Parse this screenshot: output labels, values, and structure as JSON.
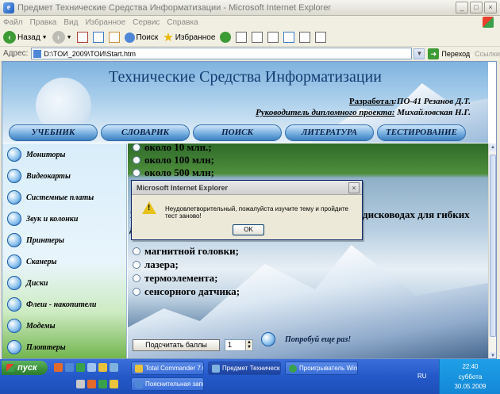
{
  "window": {
    "title": "Предмет Технические Средства Информатизации - Microsoft Internet Explorer",
    "minimize": "_",
    "maximize": "□",
    "close": "×"
  },
  "menu": [
    "Файл",
    "Правка",
    "Вид",
    "Избранное",
    "Сервис",
    "Справка"
  ],
  "toolbar": {
    "back": "Назад",
    "search": "Поиск",
    "favorites": "Избранное"
  },
  "address": {
    "label": "Адрес:",
    "url": "D:\\TOИ_2009\\TOИ\\Start.htm",
    "go": "Переход",
    "links": "Ссылки"
  },
  "site": {
    "title": "Технические Средства Информатизации",
    "author_label": "Разработал",
    "author_value": ":ПО-41 Резанов Д.Т.",
    "supervisor_label": "Руководитель дипломного проекта:",
    "supervisor_value": "Михайловская Н.Г.",
    "nav": [
      "УЧЕБНИК",
      "СЛОВАРИК",
      "ПОИСК",
      "ЛИТЕРАТУРА",
      "ТЕСТИРОВАНИЕ"
    ]
  },
  "sidebar": {
    "items": [
      "Мониторы",
      "Видеокарты",
      "Системные платы",
      "Звук и колонки",
      "Принтеры",
      "Сканеры",
      "Диски",
      "Флеш - накопители",
      "Модемы",
      "Плоттеры"
    ]
  },
  "quiz": {
    "prev_options": [
      "около 10 млн.;",
      "около 100 млн;",
      "около 500 млн;"
    ],
    "question_prefix": "10",
    "question_suffix": "дисководах для гибких",
    "question_line2": "ди",
    "options": [
      "магнитной головки;",
      "лазера;",
      "термоэлемента;",
      "сенсорного датчика;"
    ],
    "score_button": "Подсчитать баллы",
    "score_value": "1",
    "retry": "Попробуй еще раз!"
  },
  "dialog": {
    "title": "Microsoft Internet Explorer",
    "message": "Неудовлетворительный, пожалуйста изучите тему и пройдите тест заново!",
    "ok": "OK",
    "close": "×"
  },
  "taskbar": {
    "start": "пуск",
    "tasks": [
      "Total Commander 7.0...",
      "Предмет Технически...",
      "Проигрыватель Win...",
      "Пояснительная запи..."
    ],
    "lang": "RU",
    "time": "22:40",
    "day": "суббота",
    "date": "30.05.2009"
  }
}
